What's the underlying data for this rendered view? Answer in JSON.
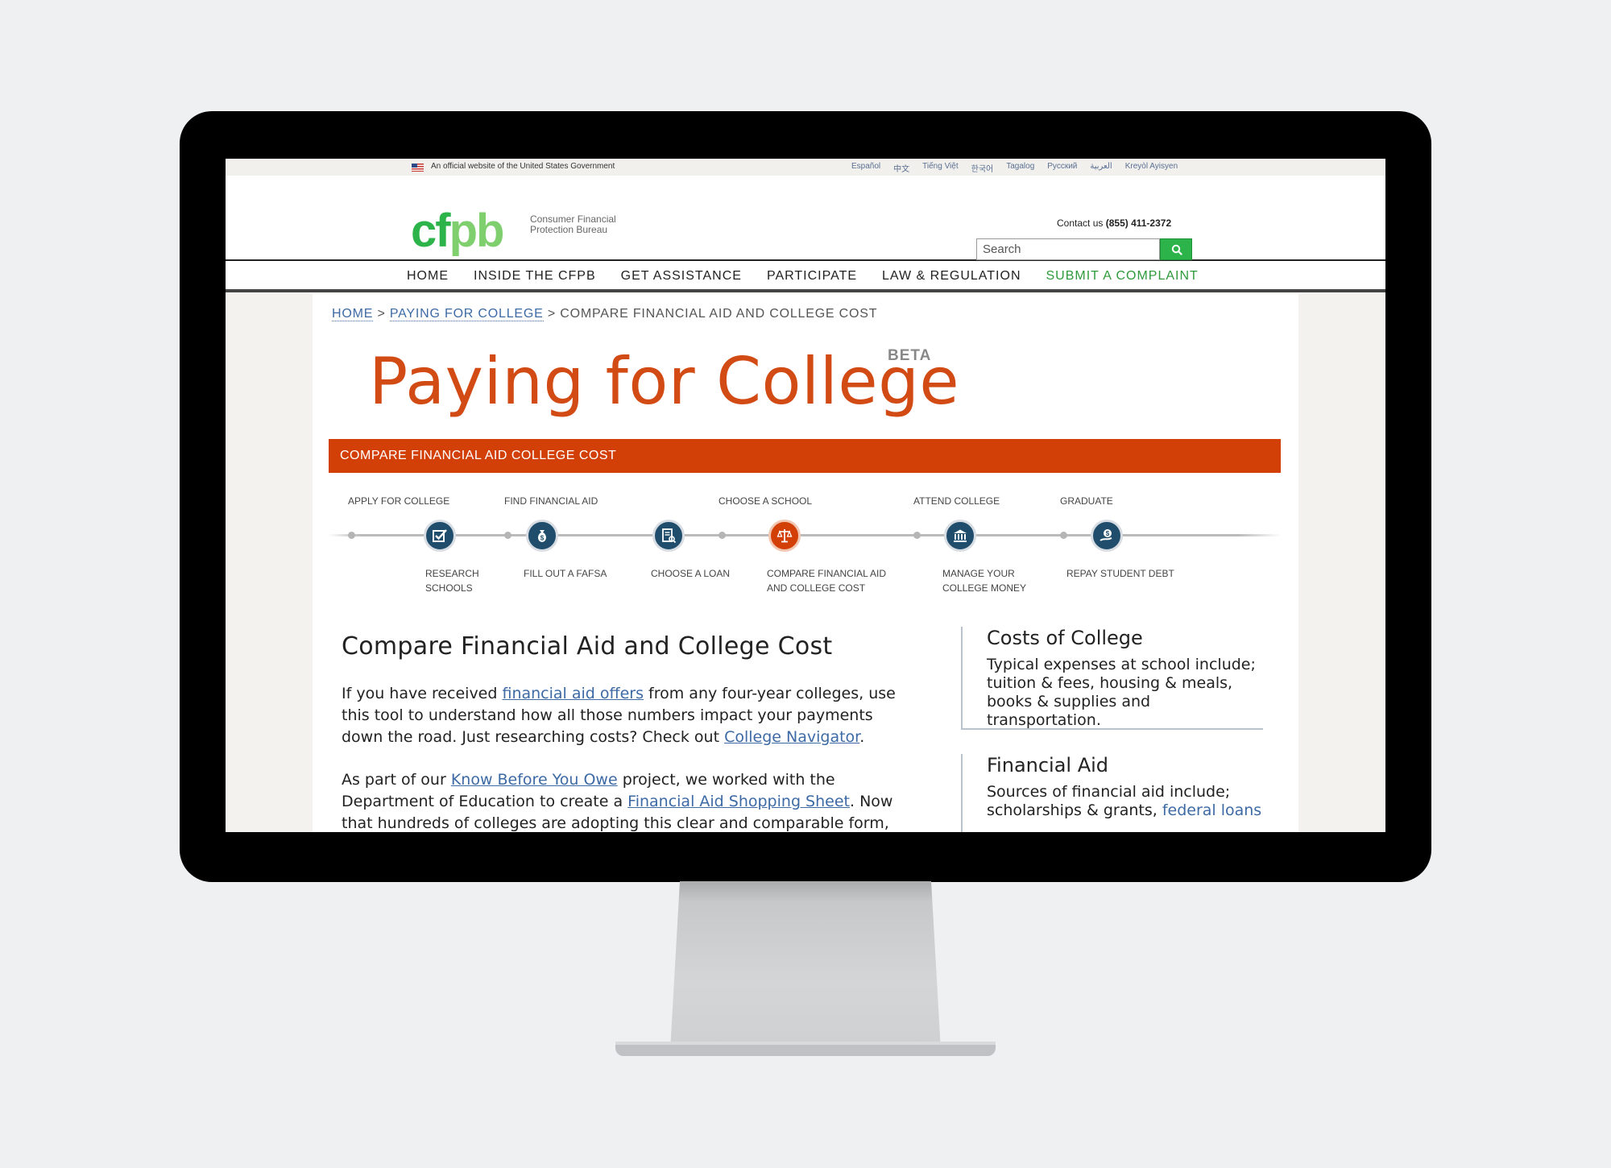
{
  "gov_banner": {
    "text": "An official website of the United States Government",
    "languages": [
      "Español",
      "中文",
      "Tiếng Việt",
      "한국어",
      "Tagalog",
      "Русский",
      "العربية",
      "Kreyòl Ayisyen"
    ]
  },
  "header": {
    "logo_letters": [
      "cf",
      "pb"
    ],
    "logo_line1": "Consumer Financial",
    "logo_line2": "Protection Bureau",
    "contact_label": "Contact us",
    "contact_phone": "(855) 411-2372",
    "search_placeholder": "Search"
  },
  "nav": [
    "HOME",
    "INSIDE THE CFPB",
    "GET ASSISTANCE",
    "PARTICIPATE",
    "LAW & REGULATION",
    "SUBMIT A COMPLAINT"
  ],
  "breadcrumb": {
    "home": "HOME",
    "sep": ">",
    "parent": "PAYING FOR COLLEGE",
    "current": "COMPARE FINANCIAL AID AND COLLEGE COST"
  },
  "page": {
    "title": "Paying for College",
    "badge": "BETA",
    "tool_banner": "COMPARE FINANCIAL AID COLLEGE COST"
  },
  "journey": {
    "phases": [
      "APPLY FOR COLLEGE",
      "FIND FINANCIAL AID",
      "CHOOSE A SCHOOL",
      "ATTEND COLLEGE",
      "GRADUATE"
    ],
    "steps": [
      {
        "line1": "RESEARCH",
        "line2": "SCHOOLS",
        "icon": "checkbox-icon"
      },
      {
        "line1": "FILL OUT A FAFSA",
        "line2": "",
        "icon": "money-bag-icon"
      },
      {
        "line1": "CHOOSE A LOAN",
        "line2": "",
        "icon": "document-icon"
      },
      {
        "line1": "COMPARE FINANCIAL AID",
        "line2": "AND COLLEGE COST",
        "icon": "scales-icon",
        "active": true
      },
      {
        "line1": "MANAGE YOUR",
        "line2": "COLLEGE MONEY",
        "icon": "bank-icon"
      },
      {
        "line1": "REPAY STUDENT DEBT",
        "line2": "",
        "icon": "pay-icon"
      }
    ]
  },
  "main": {
    "heading": "Compare Financial Aid and College Cost",
    "p1_a": "If you have received ",
    "p1_link1": "financial aid offers",
    "p1_b": " from any four-year colleges, use this tool to understand how all those numbers impact your payments down the road. Just researching costs? Check out ",
    "p1_link2": "College Navigator",
    "p1_c": ".",
    "p2_a": "As part of our ",
    "p2_link1": "Know Before You Owe",
    "p2_b": " project, we worked with the Department of Education to create a ",
    "p2_link2": "Financial Aid Shopping Sheet",
    "p2_c": ". Now that hundreds of colleges are adopting this clear and comparable form, we are"
  },
  "sidebar": {
    "box1_title": "Costs of College",
    "box1_text": "Typical expenses at school include; tuition & fees, housing & meals, books & supplies and transportation.",
    "box2_title": "Financial Aid",
    "box2_text": "Sources of financial aid include; scholarships & grants, ",
    "box2_link": "federal loans"
  },
  "colors": {
    "brand_green": "#2cb34a",
    "accent_orange": "#d24008",
    "link_blue": "#3d6aa5",
    "step_navy": "#1f4d6b"
  }
}
